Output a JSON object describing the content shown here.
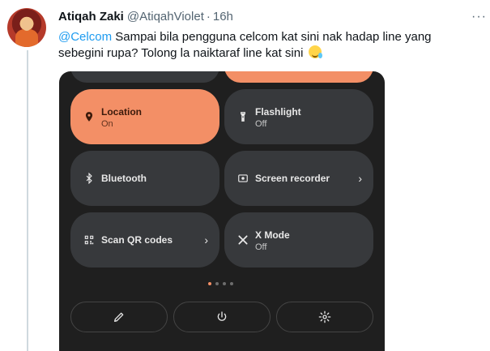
{
  "tweet": {
    "author_name": "Atiqah Zaki",
    "author_handle": "@AtiqahViolet",
    "separator": "·",
    "time": "16h",
    "more_icon": "more-icon",
    "mention": "@Celcom",
    "text": " Sampai bila pengguna celcom kat sini nak hadap line yang sebegini rupa? Tolong la naiktaraf line kat sini",
    "emoji": "drooling-face-emoji"
  },
  "quick_settings": {
    "tiles": [
      {
        "title": "Location",
        "subtitle": "On",
        "icon": "location-pin-icon",
        "active": true
      },
      {
        "title": "Flashlight",
        "subtitle": "Off",
        "icon": "flashlight-icon",
        "active": false
      },
      {
        "title": "Bluetooth",
        "subtitle": "",
        "icon": "bluetooth-icon",
        "active": false
      },
      {
        "title": "Screen recorder",
        "subtitle": "",
        "icon": "screen-record-icon",
        "active": false,
        "has_chevron": true
      },
      {
        "title": "Scan QR codes",
        "subtitle": "",
        "icon": "qr-code-icon",
        "active": false,
        "has_chevron": true
      },
      {
        "title": "X Mode",
        "subtitle": "Off",
        "icon": "x-mode-icon",
        "active": false
      }
    ],
    "chevron": "›",
    "page_indicator": {
      "pages": 4,
      "current": 1
    },
    "bottom_buttons": [
      "edit-pencil-icon",
      "power-icon",
      "settings-gear-icon"
    ],
    "colors": {
      "active_tile": "#f38f66",
      "inactive_tile": "#37393c",
      "panel_bg": "#1f1f1f"
    }
  }
}
